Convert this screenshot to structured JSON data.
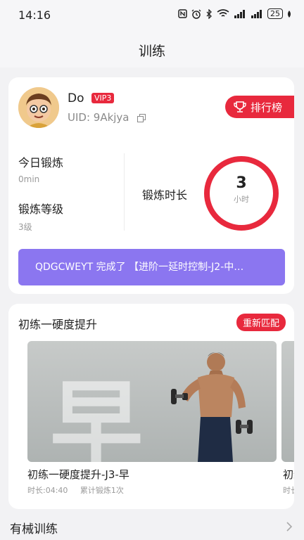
{
  "status_bar": {
    "time": "14:16",
    "battery": "25"
  },
  "header": {
    "title": "训练"
  },
  "profile": {
    "name": "Do",
    "vip_badge": "VIP3",
    "uid": "UID: 9Akjya",
    "rank_button": "排行榜"
  },
  "stats": {
    "today_label": "今日锻炼",
    "today_value": "0min",
    "level_label": "锻炼等级",
    "level_value": "3级",
    "duration_label": "锻炼时长",
    "duration_value": "3",
    "duration_unit": "小时"
  },
  "notice": {
    "text": "QDGCWEYT 完成了 【进阶一延时控制-J2-中…"
  },
  "plan": {
    "title": "初练一硬度提升",
    "rematch_button": "重新匹配",
    "image_char": "早",
    "workout_name": "初练一硬度提升-J3-早",
    "duration": "时长:04:40",
    "count": "累计锻炼1次",
    "peek_name": "初练",
    "peek_meta": "时长"
  },
  "sections": {
    "equipment_training": "有械训练"
  },
  "colors": {
    "accent_red": "#e8293d",
    "notice_purple": "#8b76f0",
    "background": "#f2f2f4"
  },
  "icons": [
    "nfc-icon",
    "alarm-icon",
    "bluetooth-icon",
    "wifi-icon",
    "signal-icon",
    "battery-icon",
    "copy-icon",
    "trophy-icon",
    "chevron-right-icon"
  ]
}
